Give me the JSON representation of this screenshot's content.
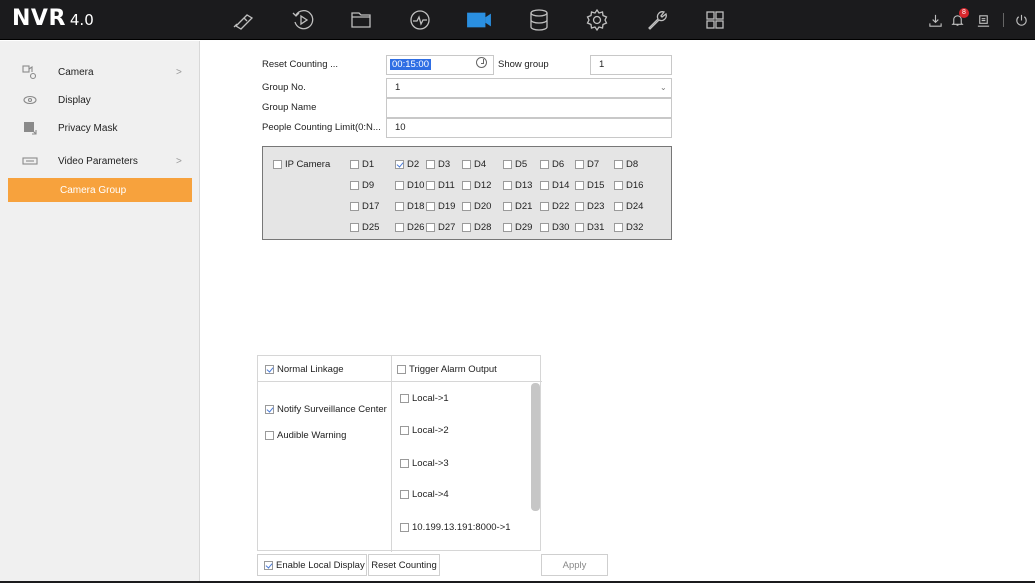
{
  "app": {
    "name": "NVR",
    "version": "4.0"
  },
  "topbar": {
    "nav_icons": [
      "live-view-icon",
      "playback-icon",
      "file-management-icon",
      "smart-analysis-icon",
      "camera-icon",
      "storage-icon",
      "system-settings-icon",
      "maintenance-icon",
      "layout-icon"
    ],
    "active_icon": "camera-icon",
    "status_icons": [
      "download-icon",
      "alarm-bell-icon",
      "user-icon",
      "power-icon"
    ],
    "alarm_badge": "8"
  },
  "sidebar": {
    "items": [
      {
        "label": "Camera",
        "icon": "camera-icon",
        "arrow": ">"
      },
      {
        "label": "Display",
        "icon": "display-icon",
        "arrow": ""
      },
      {
        "label": "Privacy Mask",
        "icon": "privacy-mask-icon",
        "arrow": ""
      },
      {
        "label": "Video Parameters",
        "icon": "video-parameters-icon",
        "arrow": ">"
      }
    ],
    "active_sub": "Camera Group"
  },
  "form": {
    "reset_counting_label": "Reset Counting ...",
    "reset_counting_value": "00:15:00",
    "show_group_label": "Show group",
    "show_group_value": "1",
    "group_no_label": "Group No.",
    "group_no_value": "1",
    "group_name_label": "Group Name",
    "group_name_value": "",
    "people_limit_label": "People Counting Limit(0:N...",
    "people_limit_value": "10"
  },
  "cameras": {
    "ip_camera_label": "IP Camera",
    "rows": [
      [
        {
          "label": "D1",
          "checked": false
        },
        {
          "label": "D2",
          "checked": true
        },
        {
          "label": "D3",
          "checked": false
        },
        {
          "label": "D4",
          "checked": false
        },
        {
          "label": "D5",
          "checked": false
        },
        {
          "label": "D6",
          "checked": false
        },
        {
          "label": "D7",
          "checked": false
        },
        {
          "label": "D8",
          "checked": false
        }
      ],
      [
        {
          "label": "D9",
          "checked": false
        },
        {
          "label": "D10",
          "checked": false
        },
        {
          "label": "D11",
          "checked": false
        },
        {
          "label": "D12",
          "checked": false
        },
        {
          "label": "D13",
          "checked": false
        },
        {
          "label": "D14",
          "checked": false
        },
        {
          "label": "D15",
          "checked": false
        },
        {
          "label": "D16",
          "checked": false
        }
      ],
      [
        {
          "label": "D17",
          "checked": false
        },
        {
          "label": "D18",
          "checked": false
        },
        {
          "label": "D19",
          "checked": false
        },
        {
          "label": "D20",
          "checked": false
        },
        {
          "label": "D21",
          "checked": false
        },
        {
          "label": "D22",
          "checked": false
        },
        {
          "label": "D23",
          "checked": false
        },
        {
          "label": "D24",
          "checked": false
        }
      ],
      [
        {
          "label": "D25",
          "checked": false
        },
        {
          "label": "D26",
          "checked": false
        },
        {
          "label": "D27",
          "checked": false
        },
        {
          "label": "D28",
          "checked": false
        },
        {
          "label": "D29",
          "checked": false
        },
        {
          "label": "D30",
          "checked": false
        },
        {
          "label": "D31",
          "checked": false
        },
        {
          "label": "D32",
          "checked": false
        }
      ]
    ]
  },
  "linkage": {
    "normal_label": "Normal Linkage",
    "normal_checked": true,
    "trigger_label": "Trigger Alarm Output",
    "trigger_checked": false,
    "normal_items": [
      {
        "label": "Notify Surveillance Center",
        "checked": true
      },
      {
        "label": "Audible Warning",
        "checked": false
      }
    ],
    "outputs": [
      {
        "label": "Local->1",
        "checked": false
      },
      {
        "label": "Local->2",
        "checked": false
      },
      {
        "label": "Local->3",
        "checked": false
      },
      {
        "label": "Local->4",
        "checked": false
      },
      {
        "label": "10.199.13.191:8000->1",
        "checked": false
      }
    ]
  },
  "footer": {
    "enable_local_display_label": "Enable Local Display",
    "enable_local_display_checked": true,
    "reset_counting_button": "Reset Counting",
    "apply_button": "Apply"
  }
}
